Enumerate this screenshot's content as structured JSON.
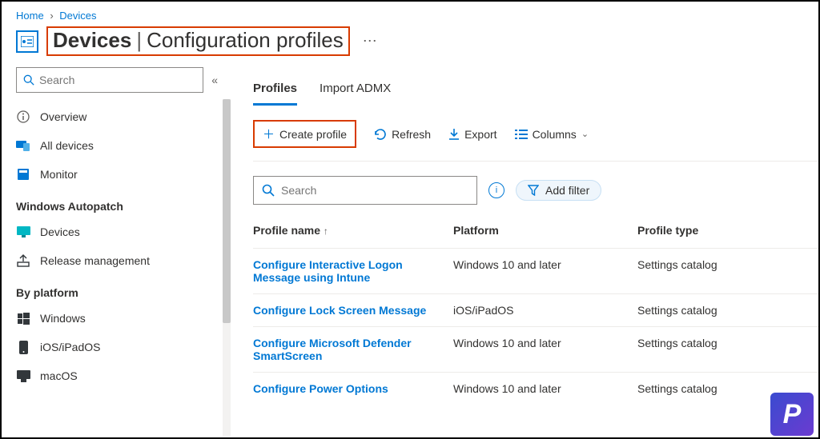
{
  "breadcrumb": {
    "home": "Home",
    "devices": "Devices"
  },
  "title": {
    "heavy": "Devices",
    "light": "Configuration profiles"
  },
  "sidebar": {
    "search_placeholder": "Search",
    "items": [
      {
        "label": "Overview"
      },
      {
        "label": "All devices"
      },
      {
        "label": "Monitor"
      }
    ],
    "section_autopatch": "Windows Autopatch",
    "autopatch_items": [
      {
        "label": "Devices"
      },
      {
        "label": "Release management"
      }
    ],
    "section_platform": "By platform",
    "platform_items": [
      {
        "label": "Windows"
      },
      {
        "label": "iOS/iPadOS"
      },
      {
        "label": "macOS"
      }
    ]
  },
  "tabs": {
    "profiles": "Profiles",
    "import": "Import ADMX"
  },
  "toolbar": {
    "create": "Create profile",
    "refresh": "Refresh",
    "export": "Export",
    "columns": "Columns"
  },
  "filter": {
    "search_placeholder": "Search",
    "add_filter": "Add filter"
  },
  "table": {
    "headers": {
      "name": "Profile name",
      "platform": "Platform",
      "type": "Profile type"
    },
    "rows": [
      {
        "name": "Configure Interactive Logon Message using Intune",
        "platform": "Windows 10 and later",
        "type": "Settings catalog"
      },
      {
        "name": "Configure Lock Screen Message",
        "platform": "iOS/iPadOS",
        "type": "Settings catalog"
      },
      {
        "name": "Configure Microsoft Defender SmartScreen",
        "platform": "Windows 10 and later",
        "type": "Settings catalog"
      },
      {
        "name": "Configure Power Options",
        "platform": "Windows 10 and later",
        "type": "Settings catalog"
      }
    ]
  }
}
